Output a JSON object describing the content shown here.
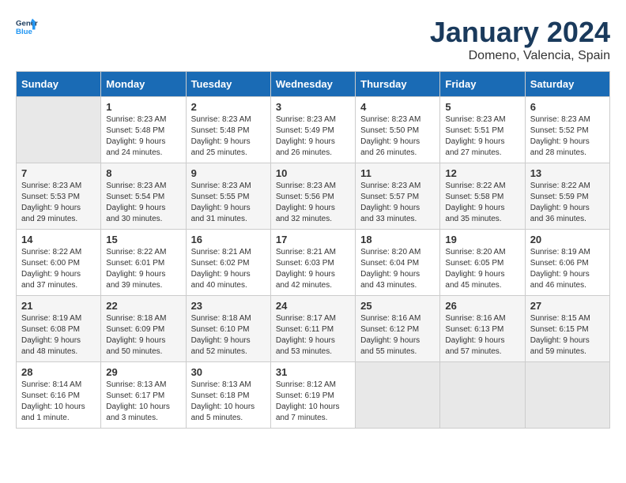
{
  "header": {
    "logo_line1": "General",
    "logo_line2": "Blue",
    "month_title": "January 2024",
    "subtitle": "Domeno, Valencia, Spain"
  },
  "weekdays": [
    "Sunday",
    "Monday",
    "Tuesday",
    "Wednesday",
    "Thursday",
    "Friday",
    "Saturday"
  ],
  "weeks": [
    [
      {
        "day": "",
        "sunrise": "",
        "sunset": "",
        "daylight": ""
      },
      {
        "day": "1",
        "sunrise": "Sunrise: 8:23 AM",
        "sunset": "Sunset: 5:48 PM",
        "daylight": "Daylight: 9 hours and 24 minutes."
      },
      {
        "day": "2",
        "sunrise": "Sunrise: 8:23 AM",
        "sunset": "Sunset: 5:48 PM",
        "daylight": "Daylight: 9 hours and 25 minutes."
      },
      {
        "day": "3",
        "sunrise": "Sunrise: 8:23 AM",
        "sunset": "Sunset: 5:49 PM",
        "daylight": "Daylight: 9 hours and 26 minutes."
      },
      {
        "day": "4",
        "sunrise": "Sunrise: 8:23 AM",
        "sunset": "Sunset: 5:50 PM",
        "daylight": "Daylight: 9 hours and 26 minutes."
      },
      {
        "day": "5",
        "sunrise": "Sunrise: 8:23 AM",
        "sunset": "Sunset: 5:51 PM",
        "daylight": "Daylight: 9 hours and 27 minutes."
      },
      {
        "day": "6",
        "sunrise": "Sunrise: 8:23 AM",
        "sunset": "Sunset: 5:52 PM",
        "daylight": "Daylight: 9 hours and 28 minutes."
      }
    ],
    [
      {
        "day": "7",
        "sunrise": "Sunrise: 8:23 AM",
        "sunset": "Sunset: 5:53 PM",
        "daylight": "Daylight: 9 hours and 29 minutes."
      },
      {
        "day": "8",
        "sunrise": "Sunrise: 8:23 AM",
        "sunset": "Sunset: 5:54 PM",
        "daylight": "Daylight: 9 hours and 30 minutes."
      },
      {
        "day": "9",
        "sunrise": "Sunrise: 8:23 AM",
        "sunset": "Sunset: 5:55 PM",
        "daylight": "Daylight: 9 hours and 31 minutes."
      },
      {
        "day": "10",
        "sunrise": "Sunrise: 8:23 AM",
        "sunset": "Sunset: 5:56 PM",
        "daylight": "Daylight: 9 hours and 32 minutes."
      },
      {
        "day": "11",
        "sunrise": "Sunrise: 8:23 AM",
        "sunset": "Sunset: 5:57 PM",
        "daylight": "Daylight: 9 hours and 33 minutes."
      },
      {
        "day": "12",
        "sunrise": "Sunrise: 8:22 AM",
        "sunset": "Sunset: 5:58 PM",
        "daylight": "Daylight: 9 hours and 35 minutes."
      },
      {
        "day": "13",
        "sunrise": "Sunrise: 8:22 AM",
        "sunset": "Sunset: 5:59 PM",
        "daylight": "Daylight: 9 hours and 36 minutes."
      }
    ],
    [
      {
        "day": "14",
        "sunrise": "Sunrise: 8:22 AM",
        "sunset": "Sunset: 6:00 PM",
        "daylight": "Daylight: 9 hours and 37 minutes."
      },
      {
        "day": "15",
        "sunrise": "Sunrise: 8:22 AM",
        "sunset": "Sunset: 6:01 PM",
        "daylight": "Daylight: 9 hours and 39 minutes."
      },
      {
        "day": "16",
        "sunrise": "Sunrise: 8:21 AM",
        "sunset": "Sunset: 6:02 PM",
        "daylight": "Daylight: 9 hours and 40 minutes."
      },
      {
        "day": "17",
        "sunrise": "Sunrise: 8:21 AM",
        "sunset": "Sunset: 6:03 PM",
        "daylight": "Daylight: 9 hours and 42 minutes."
      },
      {
        "day": "18",
        "sunrise": "Sunrise: 8:20 AM",
        "sunset": "Sunset: 6:04 PM",
        "daylight": "Daylight: 9 hours and 43 minutes."
      },
      {
        "day": "19",
        "sunrise": "Sunrise: 8:20 AM",
        "sunset": "Sunset: 6:05 PM",
        "daylight": "Daylight: 9 hours and 45 minutes."
      },
      {
        "day": "20",
        "sunrise": "Sunrise: 8:19 AM",
        "sunset": "Sunset: 6:06 PM",
        "daylight": "Daylight: 9 hours and 46 minutes."
      }
    ],
    [
      {
        "day": "21",
        "sunrise": "Sunrise: 8:19 AM",
        "sunset": "Sunset: 6:08 PM",
        "daylight": "Daylight: 9 hours and 48 minutes."
      },
      {
        "day": "22",
        "sunrise": "Sunrise: 8:18 AM",
        "sunset": "Sunset: 6:09 PM",
        "daylight": "Daylight: 9 hours and 50 minutes."
      },
      {
        "day": "23",
        "sunrise": "Sunrise: 8:18 AM",
        "sunset": "Sunset: 6:10 PM",
        "daylight": "Daylight: 9 hours and 52 minutes."
      },
      {
        "day": "24",
        "sunrise": "Sunrise: 8:17 AM",
        "sunset": "Sunset: 6:11 PM",
        "daylight": "Daylight: 9 hours and 53 minutes."
      },
      {
        "day": "25",
        "sunrise": "Sunrise: 8:16 AM",
        "sunset": "Sunset: 6:12 PM",
        "daylight": "Daylight: 9 hours and 55 minutes."
      },
      {
        "day": "26",
        "sunrise": "Sunrise: 8:16 AM",
        "sunset": "Sunset: 6:13 PM",
        "daylight": "Daylight: 9 hours and 57 minutes."
      },
      {
        "day": "27",
        "sunrise": "Sunrise: 8:15 AM",
        "sunset": "Sunset: 6:15 PM",
        "daylight": "Daylight: 9 hours and 59 minutes."
      }
    ],
    [
      {
        "day": "28",
        "sunrise": "Sunrise: 8:14 AM",
        "sunset": "Sunset: 6:16 PM",
        "daylight": "Daylight: 10 hours and 1 minute."
      },
      {
        "day": "29",
        "sunrise": "Sunrise: 8:13 AM",
        "sunset": "Sunset: 6:17 PM",
        "daylight": "Daylight: 10 hours and 3 minutes."
      },
      {
        "day": "30",
        "sunrise": "Sunrise: 8:13 AM",
        "sunset": "Sunset: 6:18 PM",
        "daylight": "Daylight: 10 hours and 5 minutes."
      },
      {
        "day": "31",
        "sunrise": "Sunrise: 8:12 AM",
        "sunset": "Sunset: 6:19 PM",
        "daylight": "Daylight: 10 hours and 7 minutes."
      },
      {
        "day": "",
        "sunrise": "",
        "sunset": "",
        "daylight": ""
      },
      {
        "day": "",
        "sunrise": "",
        "sunset": "",
        "daylight": ""
      },
      {
        "day": "",
        "sunrise": "",
        "sunset": "",
        "daylight": ""
      }
    ]
  ]
}
